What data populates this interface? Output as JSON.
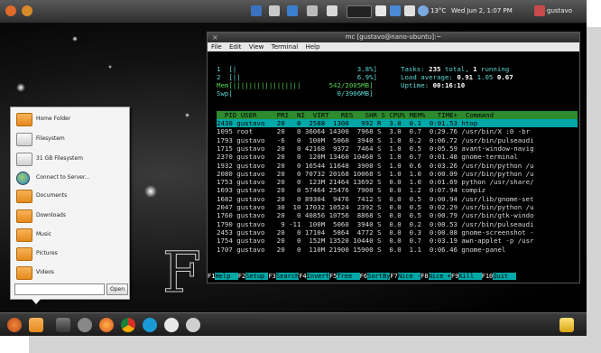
{
  "top_panel": {
    "weather": "13°C",
    "clock": "Wed Jun 2, 1:07 PM",
    "user": "gustavo"
  },
  "terminal": {
    "title": "mc [gustavo@nano-ubuntu]:~",
    "menu": [
      "File",
      "Edit",
      "View",
      "Terminal",
      "Help"
    ],
    "meters": {
      "cpu1": "1  [|                              3.8%]",
      "cpu2": "2  [||                             6.9%]",
      "mem": "Mem[|||||||||||||||||       542/2005MB]",
      "swp": "Swp[                          0/3906MB]"
    },
    "tasks": {
      "label": "Tasks:",
      "total": "235",
      "mid": "total,",
      "running": "1",
      "tail": "running"
    },
    "load": {
      "label": "Load average:",
      "v1": "0.91",
      "v2": "1.05",
      "v3": "0.67"
    },
    "uptime": {
      "label": "Uptime:",
      "value": "00:16:10"
    },
    "header": "  PID USER     PRI  NI  VIRT   RES   SHR S CPU% MEM%   TIME+  Command",
    "rows": [
      "2430 gustavo   20   0  2588  1300   992 R  3.0  0.1  0:01.53 htop",
      "1095 root      20   0 36064 14300  7968 S  3.0  0.7  0:29.76 /usr/bin/X :0 -br",
      "1793 gustavo   -6   0  100M  5060  3940 S  1.0  0.2  0:06.72 /usr/bin/pulseaudi",
      "1715 gustavo   20   0 42168  9372  7464 S  1.0  0.5  0:05.59 avant-window-navig",
      "2370 gustavo   20   0  120M 13460 10468 S  1.0  0.7  0:01.48 gnome-terminal",
      "1932 gustavo   20   0 16544 11648  3908 S  1.0  0.6  0:03.26 /usr/bin/python /u",
      "2080 gustavo   20   0 70732 20168 10068 S  1.0  1.0  0:00.09 /usr/bin/python /u",
      "1753 gustavo   20   0  123M 21464 13692 S  0.0  1.0  0:01.69 python /usr/share/",
      "1693 gustavo   20   0 57464 25476  7900 S  0.0  1.2  0:07.94 compiz",
      "1682 gustavo   20   0 89304  9476  7412 S  0.0  0.5  0:00.94 /usr/lib/gnome-set",
      "2047 gustavo   30  10 17032 10524  2392 S  0.0  0.5  0:02.29 /usr/bin/python /u",
      "1760 gustavo   20   0 40856 10756  8868 S  0.0  0.5  0:00.79 /usr/bin/gtk-windo",
      "1790 gustavo    9 -11  100M  5060  3940 S  0.0  0.2  0:00.53 /usr/bin/pulseaudi",
      "2453 gustavo   20   0 17104  5864  4772 S  0.0  0.3  0:00.08 gnome-screenshot -",
      "1754 gustavo   20   0  152M 13520 10440 S  0.0  0.7  0:03.19 awn-applet -p /usr",
      "1707 gustavo   20   0  110M 21900 15900 S  0.0  1.1  0:06.46 gnome-panel"
    ],
    "fkeys": [
      {
        "k": "F1",
        "l": "Help  "
      },
      {
        "k": "F2",
        "l": "Setup "
      },
      {
        "k": "F3",
        "l": "Search"
      },
      {
        "k": "F4",
        "l": "Invert"
      },
      {
        "k": "F5",
        "l": "Tree  "
      },
      {
        "k": "F6",
        "l": "SortBy"
      },
      {
        "k": "F7",
        "l": "Nice -"
      },
      {
        "k": "F8",
        "l": "Nice +"
      },
      {
        "k": "F9",
        "l": "Kill  "
      },
      {
        "k": "F10",
        "l": "Quit  "
      }
    ]
  },
  "places_menu": {
    "items": [
      "Home Folder",
      "Filesystem",
      "31 GB Filesystem",
      "Connect to Server...",
      "Documents",
      "Downloads",
      "Music",
      "Pictures",
      "Videos"
    ],
    "open_button": "Open"
  }
}
